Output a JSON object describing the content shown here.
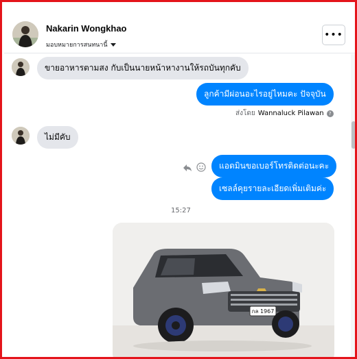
{
  "header": {
    "name": "Nakarin Wongkhao",
    "subline": "มอบหมายการสนทนานี้",
    "more_label": "•••"
  },
  "messages": [
    {
      "side": "in",
      "text": "ขายอาหารตามสง กับเป็นนายหน้าหางานให้รถบันทุกคับ"
    },
    {
      "side": "out",
      "text": "ลูกค้ามีผ่อนอะไรอยู่ไหมคะ ปัจจุบัน"
    },
    {
      "side": "in",
      "text": "ไม่มีคับ"
    },
    {
      "side": "out",
      "text": "แอดมินขอเบอร์โทรติดต่อนะคะ"
    },
    {
      "side": "out",
      "text": "เซลล์คุยรายละเอียดเพิ่มเติมค่ะ"
    }
  ],
  "sent_by": {
    "prefix": "ส่งโดย",
    "agent": "Wannaluck Pilawan",
    "help_glyph": "?"
  },
  "timestamp": "15:27",
  "photo": {
    "plate": "กล 1967",
    "car_color": "#6b6d72",
    "background_color": "#f0efed"
  },
  "colors": {
    "outgoing_bubble": "#0084ff",
    "incoming_bubble": "#e4e6eb",
    "frame_border": "#e4141b"
  },
  "icons": [
    "more-icon",
    "chevron-down-icon",
    "reply-icon",
    "emoji-icon",
    "help-icon"
  ]
}
